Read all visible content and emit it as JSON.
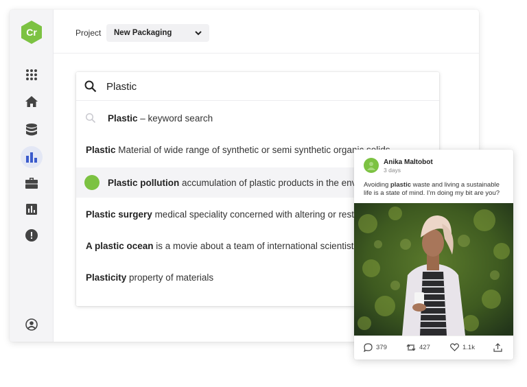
{
  "sidebar": {
    "logo_text": "Cr",
    "items": [
      {
        "icon": "apps-grid-icon"
      },
      {
        "icon": "home-icon"
      },
      {
        "icon": "database-icon"
      },
      {
        "icon": "bar-chart-icon",
        "active": true
      },
      {
        "icon": "briefcase-icon"
      },
      {
        "icon": "report-icon"
      },
      {
        "icon": "alert-icon"
      }
    ],
    "bottom_icon": "account-icon"
  },
  "header": {
    "project_label": "Project",
    "project_value": "New Packaging"
  },
  "search": {
    "query": "Plastic",
    "results": [
      {
        "term": "Plastic",
        "desc": " – keyword search",
        "icon": "search-icon"
      },
      {
        "term": "Plastic",
        "desc": " Material of wide range of synthetic or semi synthetic organic solids"
      },
      {
        "term": "Plastic pollution",
        "desc": " accumulation of plastic products in the environment",
        "icon": "green-dot"
      },
      {
        "term": "Plastic surgery",
        "desc": " medical speciality concerned with altering or restoring"
      },
      {
        "term": "A plastic ocean",
        "desc": " is a movie about a team of international scientists"
      },
      {
        "term": "Plasticity",
        "desc": " property of materials"
      }
    ]
  },
  "post": {
    "author": "Anika Maltobot",
    "time": "3 days",
    "text_before": "Avoiding ",
    "text_bold": "plastic",
    "text_after": " waste and living a sustainable life is a state of mind. I’m doing my bit are you?",
    "comments": "379",
    "reposts": "427",
    "likes": "1.1k"
  },
  "colors": {
    "brand_green": "#7cc242",
    "active_blue": "#3b5bcc",
    "icon_gray": "#444444"
  }
}
